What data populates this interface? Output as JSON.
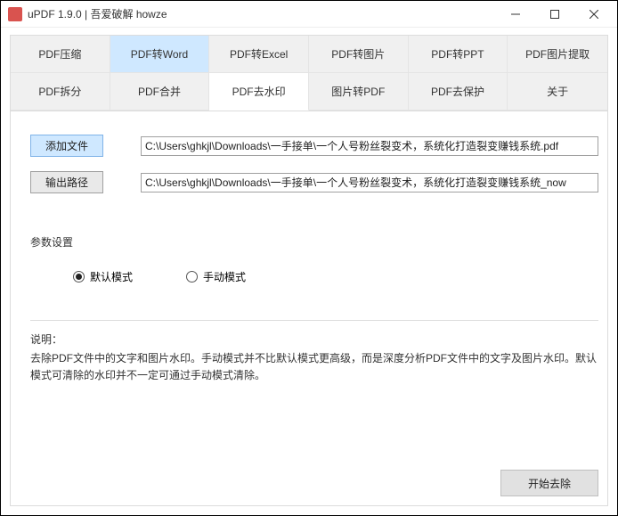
{
  "titlebar": {
    "title": "uPDF 1.9.0 |  吾爱破解 howze"
  },
  "tabs": {
    "row1": [
      {
        "label": "PDF压缩"
      },
      {
        "label": "PDF转Word"
      },
      {
        "label": "PDF转Excel"
      },
      {
        "label": "PDF转图片"
      },
      {
        "label": "PDF转PPT"
      },
      {
        "label": "PDF图片提取"
      }
    ],
    "row2": [
      {
        "label": "PDF拆分"
      },
      {
        "label": "PDF合并"
      },
      {
        "label": "PDF去水印"
      },
      {
        "label": "图片转PDF"
      },
      {
        "label": "PDF去保护"
      },
      {
        "label": "关于"
      }
    ]
  },
  "buttons": {
    "add_file": "添加文件",
    "output_path": "输出路径",
    "start": "开始去除"
  },
  "paths": {
    "input": "C:\\Users\\ghkjl\\Downloads\\一手接单\\一个人号粉丝裂变术，系统化打造裂变赚钱系统.pdf",
    "output": "C:\\Users\\ghkjl\\Downloads\\一手接单\\一个人号粉丝裂变术，系统化打造裂变赚钱系统_now"
  },
  "params": {
    "label": "参数设置",
    "default_mode": "默认模式",
    "manual_mode": "手动模式"
  },
  "description": {
    "label": "说明：",
    "text": "去除PDF文件中的文字和图片水印。手动模式并不比默认模式更高级，而是深度分析PDF文件中的文字及图片水印。默认模式可清除的水印并不一定可通过手动模式清除。"
  }
}
